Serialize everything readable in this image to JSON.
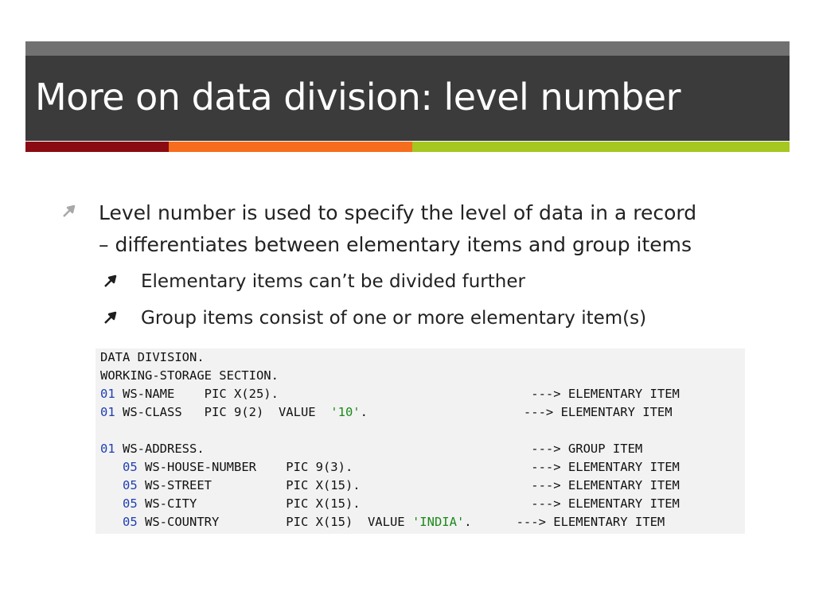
{
  "slide": {
    "title": "More on data division: level number"
  },
  "bullets": [
    {
      "line1": "Level number is used to specify the level of data in a record",
      "line2": "– differentiates between elementary items and group items"
    }
  ],
  "sub_bullets": [
    "Elementary items can’t be divided further",
    "Group items consist of one or more elementary item(s)"
  ],
  "code": {
    "lines": [
      {
        "lvl": "",
        "text": "DATA DIVISION.",
        "str": "",
        "tail": ""
      },
      {
        "lvl": "",
        "text": "WORKING-STORAGE SECTION.",
        "str": "",
        "tail": ""
      },
      {
        "lvl": "01",
        "text": " WS-NAME    PIC X(25).                                  ---> ELEMENTARY ITEM",
        "str": "",
        "tail": ""
      },
      {
        "lvl": "01",
        "text": " WS-CLASS   PIC 9(2)  VALUE  ",
        "str": "'10'",
        "tail": ".                     ---> ELEMENTARY ITEM"
      },
      {
        "lvl": "",
        "text": "",
        "str": "",
        "tail": ""
      },
      {
        "lvl": "01",
        "text": " WS-ADDRESS.                                            ---> GROUP ITEM",
        "str": "",
        "tail": ""
      },
      {
        "lvl": "   05",
        "text": " WS-HOUSE-NUMBER    PIC 9(3).                        ---> ELEMENTARY ITEM",
        "str": "",
        "tail": ""
      },
      {
        "lvl": "   05",
        "text": " WS-STREET          PIC X(15).                       ---> ELEMENTARY ITEM",
        "str": "",
        "tail": ""
      },
      {
        "lvl": "   05",
        "text": " WS-CITY            PIC X(15).                       ---> ELEMENTARY ITEM",
        "str": "",
        "tail": ""
      },
      {
        "lvl": "   05",
        "text": " WS-COUNTRY         PIC X(15)  VALUE ",
        "str": "'INDIA'",
        "tail": ".      ---> ELEMENTARY ITEM"
      }
    ]
  },
  "colors": {
    "title_band": "#3b3b3b",
    "accent_red": "#8b0b12",
    "accent_orange": "#f56d1d",
    "accent_green": "#a6c620"
  },
  "icons": {
    "bullet": "arrow-up-right-icon"
  }
}
